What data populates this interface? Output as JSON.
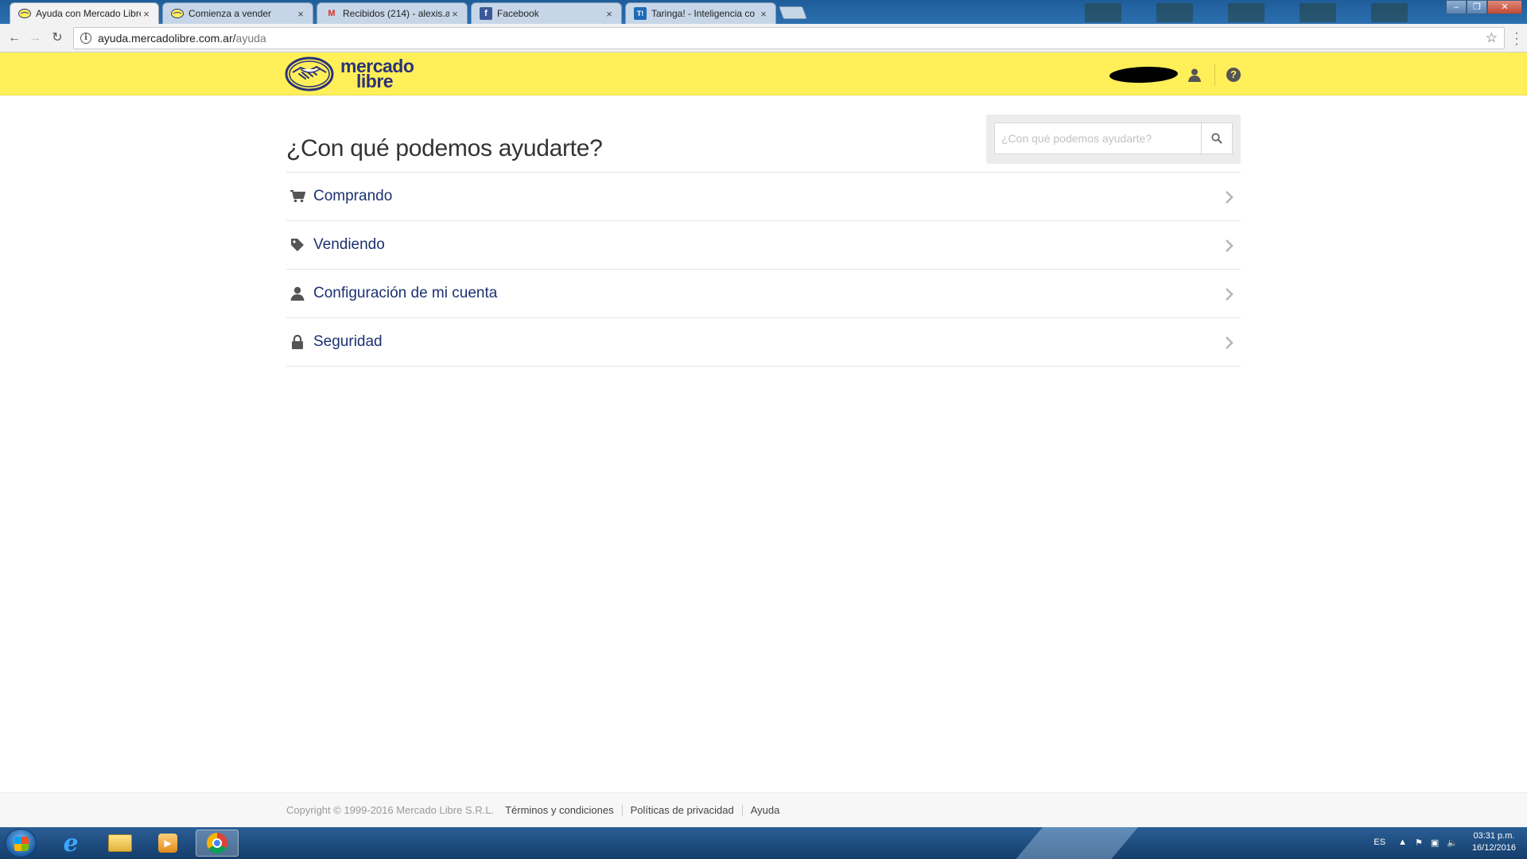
{
  "browser": {
    "tabs": [
      {
        "title": "Ayuda con Mercado Libre",
        "active": true
      },
      {
        "title": "Comienza a vender",
        "active": false
      },
      {
        "title": "Recibidos (214) - alexis.a",
        "active": false
      },
      {
        "title": "Facebook",
        "active": false
      },
      {
        "title": "Taringa! - Inteligencia co",
        "active": false
      }
    ],
    "url_host": "ayuda.mercadolibre.com.ar/",
    "url_path": "ayuda"
  },
  "header": {
    "logo_line1": "mercado",
    "logo_line2": "libre",
    "brand_yellow": "#fff059",
    "brand_blue": "#2d3277"
  },
  "main": {
    "title": "¿Con qué podemos ayudarte?",
    "search_placeholder": "¿Con qué podemos ayudarte?",
    "categories": [
      {
        "label": "Comprando",
        "icon": "cart-icon"
      },
      {
        "label": "Vendiendo",
        "icon": "tag-icon"
      },
      {
        "label": "Configuración de mi cuenta",
        "icon": "user-icon"
      },
      {
        "label": "Seguridad",
        "icon": "lock-icon"
      }
    ]
  },
  "footer": {
    "copyright": "Copyright © 1999-2016 Mercado Libre S.R.L.",
    "links": [
      "Términos y condiciones",
      "Políticas de privacidad",
      "Ayuda"
    ]
  },
  "taskbar": {
    "language": "ES",
    "time": "03:31 p.m.",
    "date": "16/12/2016"
  }
}
